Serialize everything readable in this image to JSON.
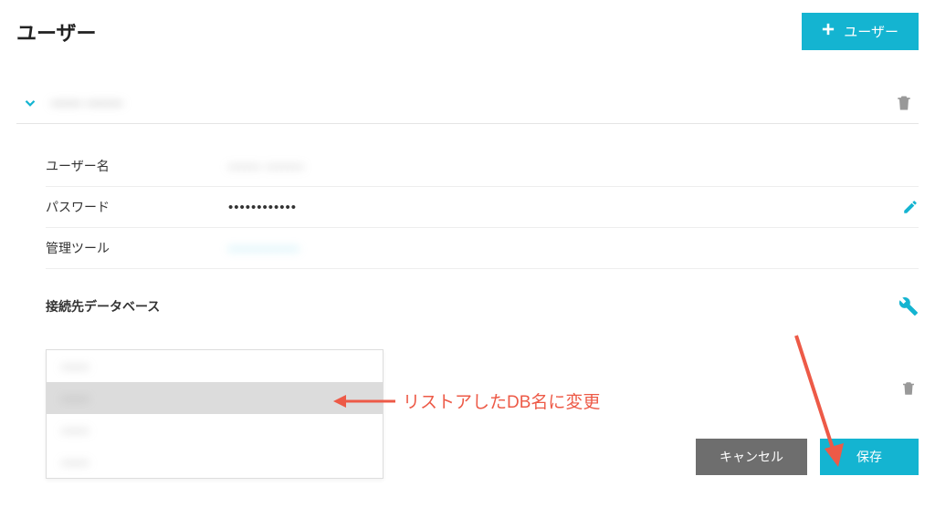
{
  "header": {
    "title": "ユーザー",
    "add_button": "ユーザー"
  },
  "user": {
    "name_redacted": "------ -------"
  },
  "details": {
    "username_label": "ユーザー名",
    "username_value": "------ -------",
    "password_label": "パスワード",
    "password_value": "••••••••••••",
    "admin_tool_label": "管理ツール",
    "admin_tool_value": "-------------"
  },
  "db": {
    "section_title": "接続先データベース",
    "options": [
      {
        "label": "-------",
        "selected": false
      },
      {
        "label": "-------",
        "selected": true
      },
      {
        "label": "-------",
        "selected": false
      },
      {
        "label": "-------",
        "selected": false
      }
    ]
  },
  "actions": {
    "cancel": "キャンセル",
    "save": "保存"
  },
  "annotations": {
    "change_to_restored": "リストアしたDB名に変更"
  },
  "colors": {
    "accent": "#14b4d1",
    "annotation": "#ed5a47"
  }
}
